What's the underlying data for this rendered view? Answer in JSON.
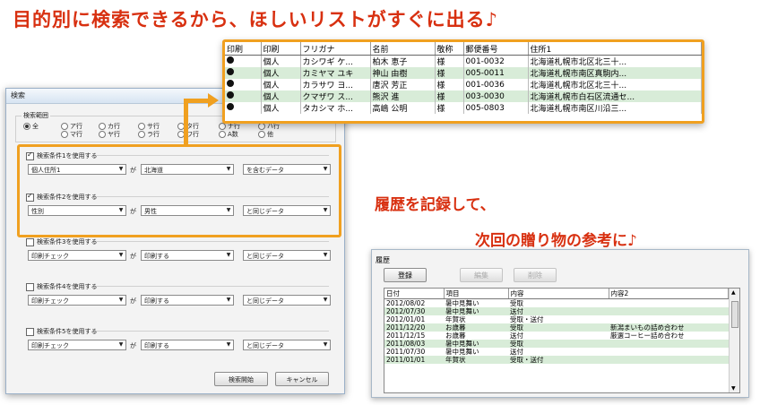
{
  "headline": "目的別に検索できるから、ほしいリストがすぐに出る♪",
  "caption_history": "履歴を記録して、",
  "caption_gift": "次回の贈り物の参考に♪",
  "search_dialog": {
    "title": "検索",
    "range_label": "検索範囲",
    "range_options": [
      {
        "label": "全",
        "selected": true
      },
      {
        "label": "ア行",
        "selected": false
      },
      {
        "label": "カ行",
        "selected": false
      },
      {
        "label": "サ行",
        "selected": false
      },
      {
        "label": "タ行",
        "selected": false
      },
      {
        "label": "ナ行",
        "selected": false
      },
      {
        "label": "ハ行",
        "selected": false
      },
      {
        "label": "マ行",
        "selected": false
      },
      {
        "label": "ヤ行",
        "selected": false
      },
      {
        "label": "ラ行",
        "selected": false
      },
      {
        "label": "ワ行",
        "selected": false
      },
      {
        "label": "A数",
        "selected": false
      },
      {
        "label": "他",
        "selected": false
      }
    ],
    "ga_label": "が",
    "conditions": [
      {
        "header": "検索条件1を使用する",
        "checked": true,
        "field": "個人住所1",
        "value": "北海道",
        "match": "を含むデータ"
      },
      {
        "header": "検索条件2を使用する",
        "checked": true,
        "field": "性別",
        "value": "男性",
        "match": "と同じデータ"
      },
      {
        "header": "検索条件3を使用する",
        "checked": false,
        "field": "印刷チェック",
        "value": "印刷する",
        "match": "と同じデータ"
      },
      {
        "header": "検索条件4を使用する",
        "checked": false,
        "field": "印刷チェック",
        "value": "印刷する",
        "match": "と同じデータ"
      },
      {
        "header": "検索条件5を使用する",
        "checked": false,
        "field": "印刷チェック",
        "value": "印刷する",
        "match": "と同じデータ"
      }
    ],
    "start_button": "検索開始",
    "cancel_button": "キャンセル"
  },
  "result_table": {
    "columns": [
      "印刷",
      "印刷",
      "フリガナ",
      "名前",
      "敬称",
      "郵便番号",
      "住所1"
    ],
    "rows": [
      {
        "c1": "個人",
        "c2": "カシワギ ケ...",
        "c3": "柏木 恵子",
        "c4": "様",
        "c5": "001-0032",
        "c6": "北海道札幌市北区北三十..."
      },
      {
        "c1": "個人",
        "c2": "カミヤマ ユキ",
        "c3": "神山 由樹",
        "c4": "様",
        "c5": "005-0011",
        "c6": "北海道札幌市南区真駒内..."
      },
      {
        "c1": "個人",
        "c2": "カラサワ ヨ...",
        "c3": "唐沢 芳正",
        "c4": "様",
        "c5": "001-0036",
        "c6": "北海道札幌市北区北三十..."
      },
      {
        "c1": "個人",
        "c2": "クマザワ ス...",
        "c3": "熊沢 進",
        "c4": "様",
        "c5": "003-0030",
        "c6": "北海道札幌市白石区流通セ..."
      },
      {
        "c1": "個人",
        "c2": "タカシマ ホ...",
        "c3": "高嶋 公明",
        "c4": "様",
        "c5": "005-0803",
        "c6": "北海道札幌市南区川沿三..."
      }
    ]
  },
  "history": {
    "group_label": "履歴",
    "register_button": "登録",
    "edit_button": "編集",
    "delete_button": "削除",
    "columns": [
      "日付",
      "項目",
      "内容",
      "内容2"
    ],
    "rows": [
      {
        "date": "2012/08/02",
        "item": "暑中見舞い",
        "content": "受取",
        "content2": ""
      },
      {
        "date": "2012/07/30",
        "item": "暑中見舞い",
        "content": "送付",
        "content2": ""
      },
      {
        "date": "2012/01/01",
        "item": "年賀状",
        "content": "受取・送付",
        "content2": ""
      },
      {
        "date": "2011/12/20",
        "item": "お歳暮",
        "content": "受取",
        "content2": "新潟まいもの詰め合わせ"
      },
      {
        "date": "2011/12/15",
        "item": "お歳暮",
        "content": "送付",
        "content2": "厳選コーヒー詰め合わせ"
      },
      {
        "date": "2011/08/03",
        "item": "暑中見舞い",
        "content": "受取",
        "content2": ""
      },
      {
        "date": "2011/07/30",
        "item": "暑中見舞い",
        "content": "送付",
        "content2": ""
      },
      {
        "date": "2011/01/01",
        "item": "年賀状",
        "content": "受取・送付",
        "content2": ""
      }
    ]
  },
  "colors": {
    "accent": "#f0a020",
    "headline": "#d83010",
    "row_highlight": "#d8ecd8"
  }
}
